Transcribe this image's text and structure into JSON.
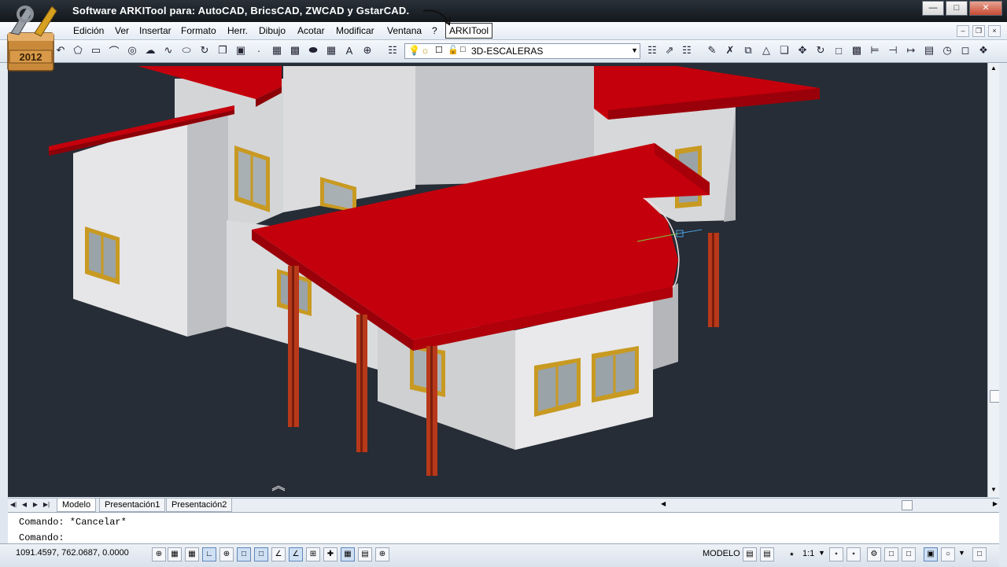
{
  "window": {
    "title": "Software ARKITool para: AutoCAD, BricsCAD, ZWCAD y GstarCAD.",
    "version_badge": "2012"
  },
  "menu": {
    "items": [
      "Edición",
      "Ver",
      "Insertar",
      "Formato",
      "Herr.",
      "Dibujo",
      "Acotar",
      "Modificar",
      "Ventana",
      "?"
    ],
    "arkitool": "ARKITool"
  },
  "toolbar": {
    "layer_name": "3D-ESCALERAS"
  },
  "tabs": {
    "items": [
      "Modelo",
      "Presentación1",
      "Presentación2"
    ]
  },
  "command": {
    "history": "Comando: *Cancelar*",
    "prompt": "Comando:"
  },
  "status": {
    "coords": "1091.4597, 762.0687, 0.0000",
    "model": "MODELO",
    "annotation_scale": "1:1"
  },
  "colors": {
    "viewport_bg": "#262d36",
    "roof_red": "#c4000c",
    "wall": "#e8e8ea",
    "window_frame": "#c89a22",
    "column": "#b8391a"
  }
}
